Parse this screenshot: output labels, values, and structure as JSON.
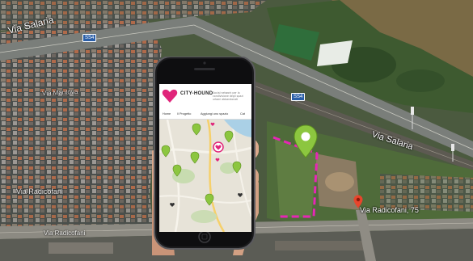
{
  "map_labels": {
    "street_1": "Via Salaria",
    "street_2": "Via Salaria",
    "street_3": "Via Radicofani",
    "street_4": "Via Radicofani",
    "street_5": "Via Mantova",
    "route_shield_1": "SS4",
    "route_shield_2": "SS4"
  },
  "location_marker": {
    "address": "Via Radicofani, 75"
  },
  "phone_app": {
    "name": "CITY-HOUND",
    "tagline": "Social network per la condivisione degli spazi urbani abbandonati",
    "nav": [
      "Home",
      "Il Progetto",
      "Aggiungi uno spazio",
      "Cat"
    ],
    "map_pins_count": 10
  },
  "colors": {
    "brand_pink": "#e0257a",
    "pin_green": "#8cc63f",
    "address_pin": "#e8452c",
    "outline_dash": "#e626b5"
  }
}
